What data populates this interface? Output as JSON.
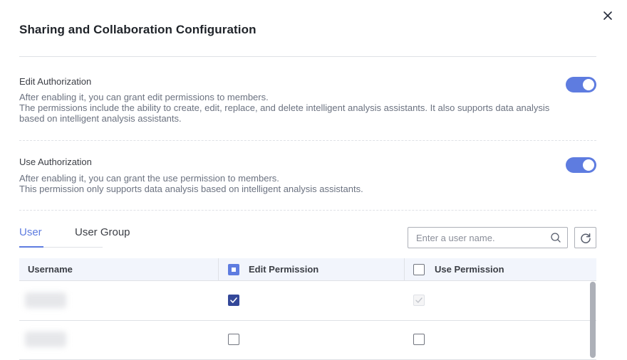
{
  "dialog": {
    "title": "Sharing and Collaboration Configuration",
    "close_icon": "close-icon"
  },
  "edit_authorization": {
    "title": "Edit Authorization",
    "description_lines": [
      "After enabling it, you can grant edit permissions to members.",
      "The permissions include the ability to create, edit, replace, and delete intelligent analysis assistants. It also supports data analysis",
      "based on intelligent analysis assistants."
    ],
    "enabled": true
  },
  "use_authorization": {
    "title": "Use Authorization",
    "description_lines": [
      "After enabling it, you can grant the use permission to members.",
      "This permission only supports data analysis based on intelligent analysis assistants."
    ],
    "enabled": true
  },
  "tabs": [
    {
      "label": "User",
      "active": true
    },
    {
      "label": "User Group",
      "active": false
    }
  ],
  "search": {
    "placeholder": "Enter a user name.",
    "value": "",
    "icon": "search-icon"
  },
  "refresh_icon": "refresh-icon",
  "table": {
    "columns": [
      "Username",
      "Edit Permission",
      "Use Permission"
    ],
    "header_checkboxes": {
      "edit": "indeterminate",
      "use": "unchecked"
    },
    "rows": [
      {
        "username": "",
        "edit": "checked",
        "use": "checked-disabled"
      },
      {
        "username": "",
        "edit": "unchecked",
        "use": "unchecked"
      }
    ]
  },
  "colors": {
    "accent": "#5e7ce0",
    "checked_dark": "#344899",
    "header_bg": "#f2f5fc",
    "border": "#dfe1e6"
  }
}
